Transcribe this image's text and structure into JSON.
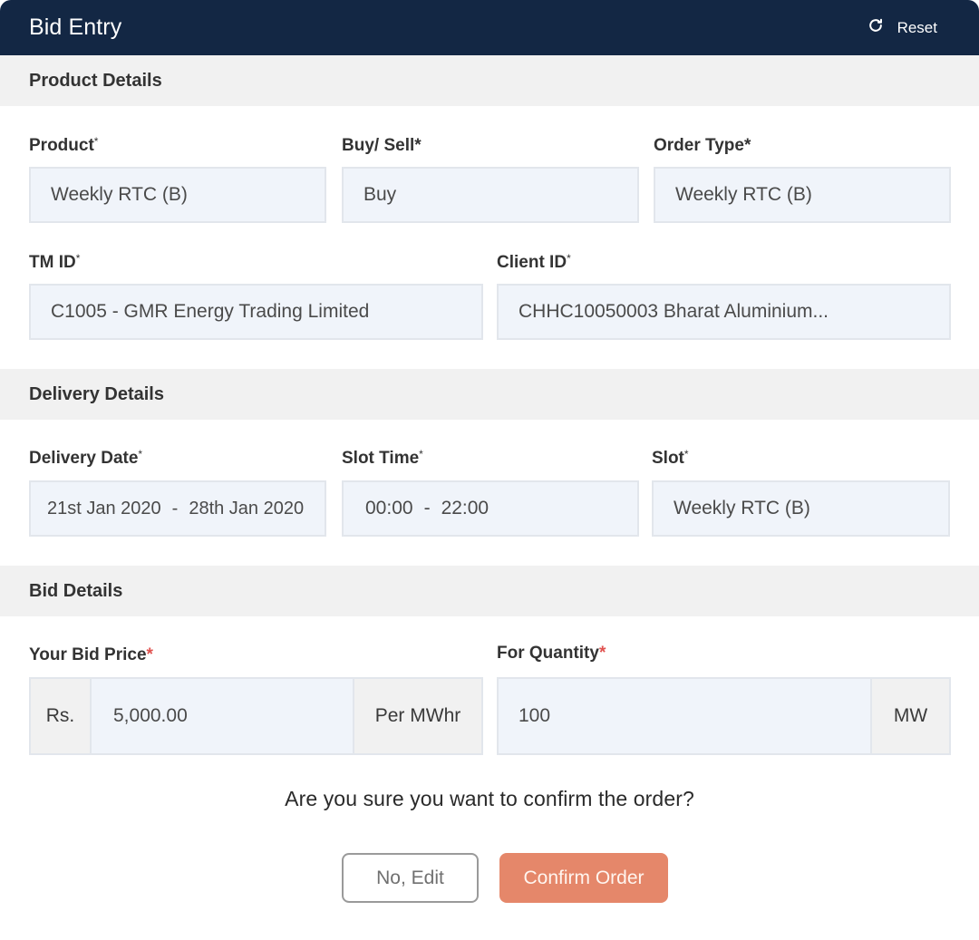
{
  "header": {
    "title": "Bid Entry",
    "reset_label": "Reset",
    "reset_icon": "refresh-icon",
    "background_color": "#132744"
  },
  "sections": {
    "product": {
      "title": "Product Details",
      "fields": {
        "product": {
          "label": "Product",
          "required_mark": "*",
          "value": "Weekly RTC (B)"
        },
        "buy_sell": {
          "label": "Buy/ Sell*",
          "value": "Buy"
        },
        "order_type": {
          "label": "Order Type*",
          "value": "Weekly RTC (B)"
        },
        "tm_id": {
          "label": "TM ID",
          "required_mark": "*",
          "value": "C1005 - GMR Energy Trading Limited"
        },
        "client_id": {
          "label": "Client ID",
          "required_mark": "*",
          "value": "CHHC10050003 Bharat Aluminium..."
        }
      }
    },
    "delivery": {
      "title": "Delivery Details",
      "fields": {
        "delivery_date": {
          "label": "Delivery Date",
          "required_mark": "*",
          "from": "21st Jan 2020",
          "separator": "-",
          "to": "28th Jan 2020"
        },
        "slot_time": {
          "label": "Slot Time",
          "required_mark": "*",
          "from": "00:00",
          "separator": "-",
          "to": "22:00"
        },
        "slot": {
          "label": "Slot",
          "required_mark": "*",
          "value": "Weekly RTC (B)"
        }
      }
    },
    "bid": {
      "title": "Bid Details",
      "fields": {
        "bid_price": {
          "label": "Your Bid Price",
          "required_mark": "*",
          "prefix": "Rs.",
          "value": "5,000.00",
          "suffix": "Per MWhr"
        },
        "quantity": {
          "label": "For Quantity",
          "required_mark": "*",
          "value": "100",
          "suffix": "MW"
        }
      }
    }
  },
  "confirmation": {
    "question": "Are you sure you want to confirm the order?",
    "edit_label": "No, Edit",
    "confirm_label": "Confirm Order",
    "confirm_color": "#e5876a",
    "required_color": "#e0524f"
  }
}
